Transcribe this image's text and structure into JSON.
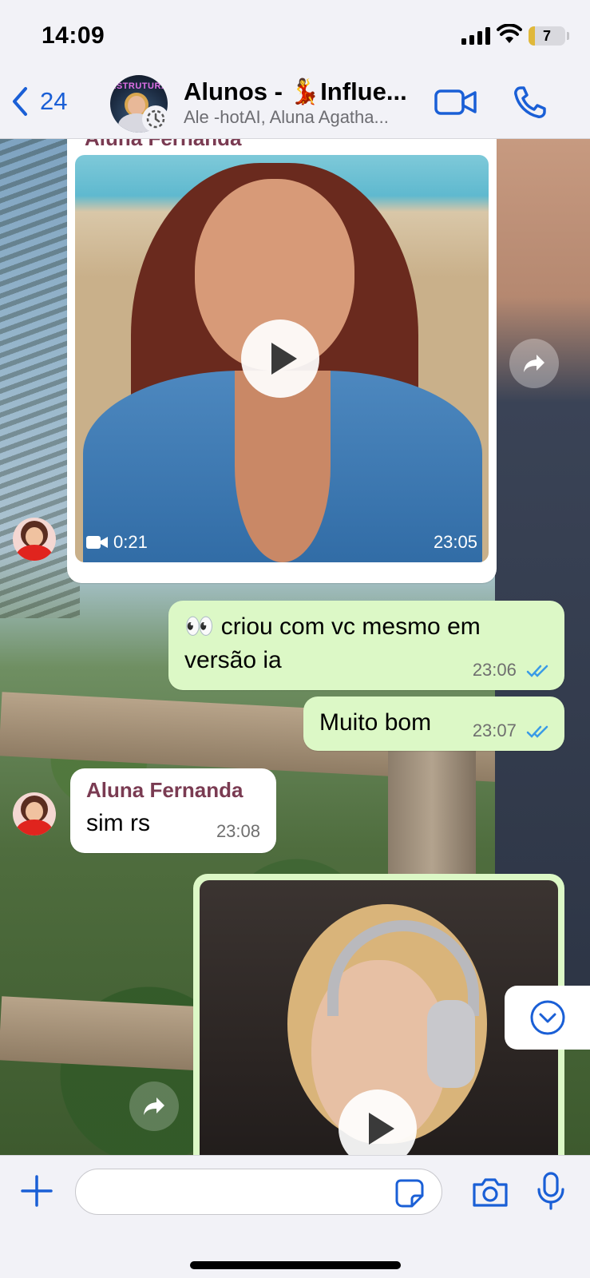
{
  "status_bar": {
    "time": "14:09",
    "battery": "7",
    "battery_level": 0.07,
    "battery_color": "#e0b83a"
  },
  "header": {
    "back_count": "24",
    "title": "Alunos - 💃Influe...",
    "subtitle": "Ale -hotAI, Aluna Agatha...",
    "avatar_brand": "ESTRUTURA"
  },
  "messages": [
    {
      "type": "video",
      "direction": "in",
      "sender": "Aluna Fernanda",
      "duration": "0:21",
      "time": "23:05"
    },
    {
      "type": "text",
      "direction": "out",
      "text": "👀 criou com vc mesmo em versão ia",
      "time": "23:06",
      "status": "read"
    },
    {
      "type": "text",
      "direction": "out",
      "text": "Muito bom",
      "time": "23:07",
      "status": "read"
    },
    {
      "type": "text",
      "direction": "in",
      "sender": "Aluna Fernanda",
      "text": "sim rs",
      "time": "23:08"
    },
    {
      "type": "video",
      "direction": "out"
    }
  ],
  "input": {
    "placeholder": ""
  },
  "colors": {
    "accent": "#1a5fd6",
    "outgoing_bubble": "#dcf8c6",
    "sender_name": "#7a3b52",
    "read_ticks": "#3a9be6"
  },
  "icons": [
    "chevron-left-icon",
    "video-camera-icon",
    "phone-icon",
    "forward-icon",
    "play-icon",
    "chevron-down-circle-icon",
    "plus-icon",
    "sticker-icon",
    "camera-icon",
    "microphone-icon"
  ]
}
